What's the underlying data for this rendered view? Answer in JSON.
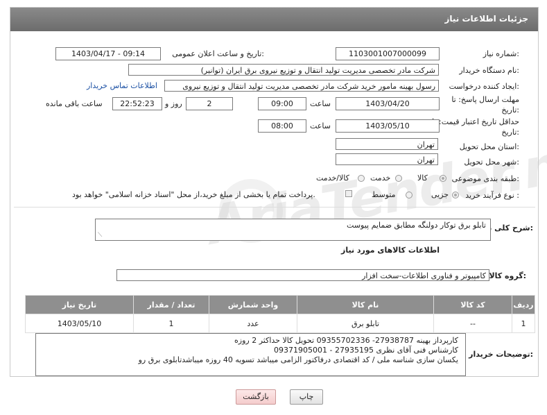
{
  "header": {
    "title": "جزئیات اطلاعات نیاز"
  },
  "fields": {
    "need_number_label": "شماره نیاز:",
    "need_number": "1103001007000099",
    "announce_label": "تاریخ و ساعت اعلان عمومی:",
    "announce_value": "1403/04/17 - 09:14",
    "buyer_label": "نام دستگاه خریدار:",
    "buyer_value": "شرکت مادر تخصصی مدیریت تولید  انتقال و توزیع نیروی برق ایران (توانیر)",
    "creator_label": "ایجاد کننده درخواست:",
    "creator_value": "رسول بهینه مامور خرید شرکت مادر تخصصی مدیریت تولید  انتقال و توزیع نیروی",
    "contact_link": "اطلاعات تماس خریدار",
    "deadline_label": "مهلت ارسال پاسخ: تا تاریخ:",
    "deadline_date": "1403/04/20",
    "time_label": "ساعت",
    "deadline_time": "09:00",
    "days_value": "2",
    "days_label": "روز و",
    "remaining_time": "22:52:23",
    "remaining_label": "ساعت باقی مانده",
    "validity_label": "حداقل تاریخ اعتبار قیمت: تا تاریخ:",
    "validity_date": "1403/05/10",
    "validity_time": "08:00",
    "province_label": "استان محل تحویل:",
    "province_value": "تهران",
    "city_label": "شهر محل تحویل:",
    "city_value": "تهران",
    "category_label": "طبقه بندی موضوعی:",
    "category_opt1": "کالا",
    "category_opt2": "خدمت",
    "category_opt3": "کالا/خدمت",
    "process_label": "نوع فرآیند خرید :",
    "process_opt1": "جزیی",
    "process_opt2": "متوسط",
    "process_note": "پرداخت تمام یا بخشی از مبلغ خرید،از محل \"اسناد خزانه اسلامی\" خواهد بود."
  },
  "summary": {
    "label": "شرح کلی نیاز:",
    "value": "تابلو برق توکار دولنگه مطابق ضمایم پیوست"
  },
  "goods": {
    "section_title": "اطلاعات کالاهای مورد نیاز",
    "group_label": "گروه کالا:",
    "group_value": "کامپیوتر و فناوری اطلاعات-سخت افزار"
  },
  "table": {
    "headers": [
      "ردیف",
      "کد کالا",
      "نام کالا",
      "واحد شمارش",
      "تعداد / مقدار",
      "تاریخ نیاز"
    ],
    "rows": [
      [
        "1",
        "--",
        "تابلو برق",
        "عدد",
        "1",
        "1403/05/10"
      ]
    ]
  },
  "buyer_notes": {
    "label": "توضیحات خریدار:",
    "lines": [
      "کارپرداز بهینه 27938787-  09355702336   تحویل کالا حداکثر 2 روزه",
      "کارشناس فنی آقای نظری 27935195 - 09371905001",
      "یکسان سازی شناسه ملی / کد اقتصادی درفاکتور الزامی میباشد     تسویه 40 روزه میباشدتابلوی برق رو"
    ]
  },
  "buttons": {
    "print": "چاپ",
    "back": "بازگشت"
  },
  "watermark": "AriaTender.neT"
}
